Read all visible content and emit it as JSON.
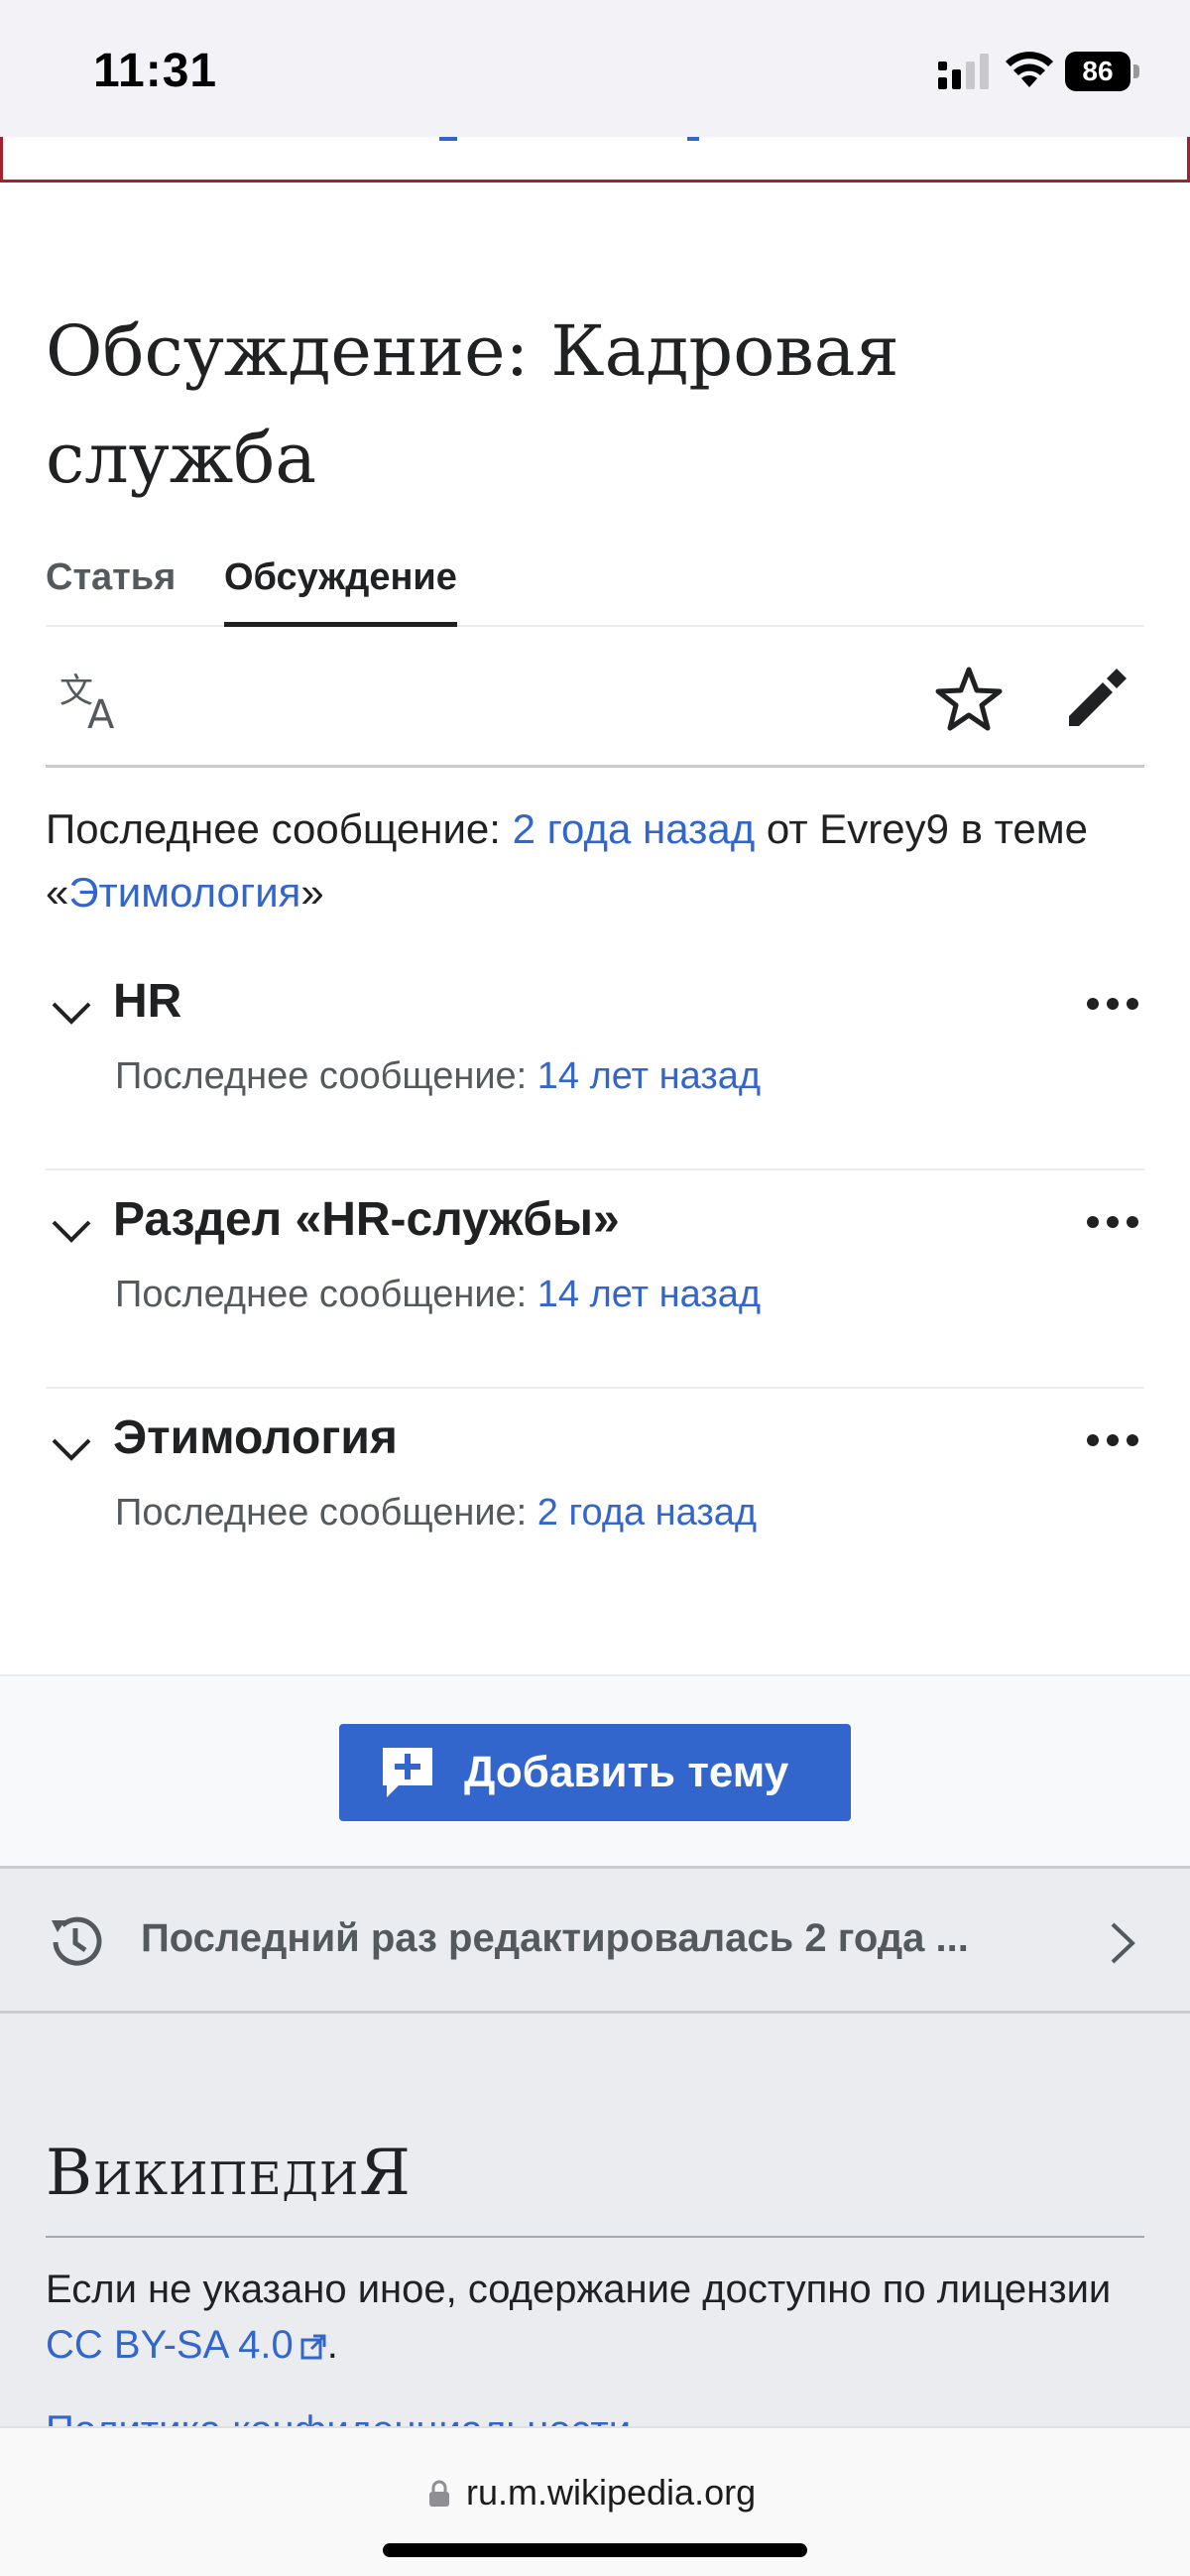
{
  "status_bar": {
    "time": "11:31",
    "battery": "86"
  },
  "page": {
    "title_line1": "Обсуждение: Кадровая",
    "title_line2": "служба"
  },
  "tabs": [
    {
      "label": "Статья",
      "active": false
    },
    {
      "label": "Обсуждение",
      "active": true
    }
  ],
  "toolbar": {
    "language_icon": "language-icon",
    "watch_icon": "star-icon",
    "edit_icon": "pencil-icon"
  },
  "summary": {
    "prefix": "Последнее сообщение: ",
    "time_link": "2 года назад",
    "middle": " от Evrey9 в теме «",
    "topic_link": "Этимология",
    "suffix": "»"
  },
  "topics": [
    {
      "title": "HR",
      "meta_prefix": "Последнее сообщение: ",
      "meta_link": "14 лет назад"
    },
    {
      "title": "Раздел «HR-службы»",
      "meta_prefix": "Последнее сообщение: ",
      "meta_link": "14 лет назад"
    },
    {
      "title": "Этимология",
      "meta_prefix": "Последнее сообщение: ",
      "meta_link": "2 года назад"
    }
  ],
  "add_topic": {
    "label": "Добавить тему"
  },
  "last_edited": {
    "text": "Последний раз редактировалась 2 года ..."
  },
  "footer": {
    "wordmark": "ВикипедиЯ",
    "license_text": "Если не указано иное, содержание доступно по лицензии ",
    "license_link": "CC BY-SA 4.0",
    "license_end": ".",
    "privacy_link": "Политика конфиденциальности"
  },
  "browser": {
    "url": "ru.m.wikipedia.org"
  },
  "colors": {
    "link": "#3366cc",
    "text": "#202122",
    "muted": "#54595d",
    "button": "#3366cc"
  }
}
